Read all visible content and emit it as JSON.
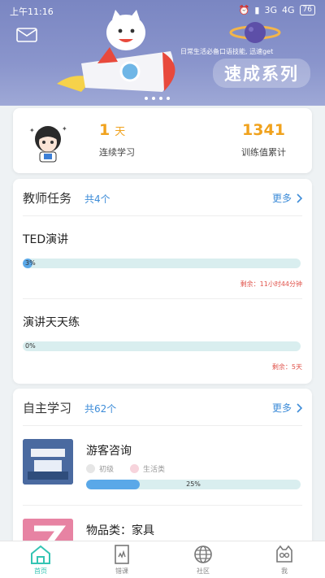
{
  "status_bar": {
    "time": "上午11:16",
    "network_1": "3G",
    "network_2": "4G",
    "battery": "76"
  },
  "banner": {
    "slogan": "日常生活必备口语技能, 迅速get",
    "series_title": "速成系列",
    "icons": [
      "mail-icon",
      "planet-icon",
      "rocket-illustration"
    ]
  },
  "stats": {
    "days_value": "1",
    "days_unit": "天",
    "days_label": "连续学习",
    "total_value": "1341",
    "total_label": "训练值累计"
  },
  "teacher_tasks": {
    "title": "教师任务",
    "count": "共4个",
    "more": "更多",
    "items": [
      {
        "name": "TED演讲",
        "percent": "3%",
        "progress": 0.03,
        "remaining": "剩余：11小时44分钟"
      },
      {
        "name": "演讲天天练",
        "percent": "0%",
        "progress": 0.0,
        "remaining": "剩余：5天"
      }
    ]
  },
  "self_study": {
    "title": "自主学习",
    "count": "共62个",
    "more": "更多",
    "items": [
      {
        "name": "游客咨询",
        "level": "初级",
        "category": "生活类",
        "percent": "25%",
        "progress": 0.25,
        "thumb_text": "Information Desk"
      },
      {
        "name": "物品类：家具",
        "level": "",
        "category": "",
        "percent": "",
        "progress": 0,
        "thumb_text": "Z"
      }
    ]
  },
  "bottom_nav": {
    "items": [
      {
        "label": "首页",
        "icon": "home-icon",
        "active": true
      },
      {
        "label": "错课",
        "icon": "book-icon",
        "active": false
      },
      {
        "label": "社区",
        "icon": "globe-icon",
        "active": false
      },
      {
        "label": "我",
        "icon": "cat-face-icon",
        "active": false
      }
    ]
  },
  "colors": {
    "accent": "#33c4b3",
    "link": "#3d8cd8",
    "highlight": "#f0a21d",
    "warning": "#e0524a",
    "progress": "#5aa8e8"
  }
}
